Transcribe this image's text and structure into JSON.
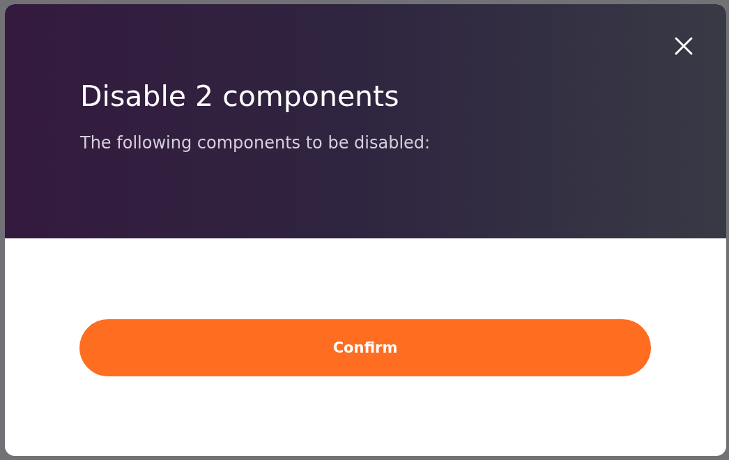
{
  "dialog": {
    "title": "Disable 2 components",
    "message": "The following components to be disabled:",
    "confirm_button": "Confirm"
  }
}
